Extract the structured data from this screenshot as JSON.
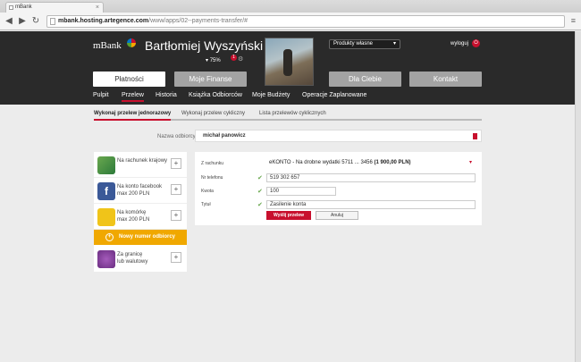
{
  "browser": {
    "tab_title": "mBank",
    "url_domain": "mbank.hosting.artegence.com",
    "url_path": "/www/apps/02--payments-transfer/#"
  },
  "header": {
    "logo": "mBank",
    "user_name": "Bartłomiej Wyszyński",
    "percent": "75%",
    "notifications": "1",
    "products_select": "Produkty własne",
    "logout": "wyloguj"
  },
  "main_tabs": [
    "Płatności",
    "Moje Finanse",
    "Dla Ciebie",
    "Kontakt"
  ],
  "sub_nav": [
    "Pulpit",
    "Przelew",
    "Historia",
    "Książka Odbiorców",
    "Moje Budżety",
    "Operacje Zaplanowane"
  ],
  "transfer_tabs": [
    "Wykonaj przelew jednorazowy",
    "Wykonaj przelew cykliczny",
    "Lista przelewów cyklicznych"
  ],
  "recipient": {
    "label": "Nazwa odbiorcy",
    "value": "michał panowicz"
  },
  "options": [
    {
      "line1": "Na rachunek krajowy",
      "line2": ""
    },
    {
      "line1": "Na konto facebook",
      "line2": "max 200 PLN"
    },
    {
      "line1": "Na komórkę",
      "line2": "max 200 PLN"
    },
    {
      "line1": "Za granicę",
      "line2": "lub walutowy"
    }
  ],
  "new_recipient": "Nowy numer odbiorcy",
  "form": {
    "from_label": "Z rachunku",
    "from_value": "eKONTO - Na drobne wydatki 5711 ... 3456 ",
    "from_balance": "(1 900,00 PLN)",
    "phone_label": "Nr telefonu",
    "phone_value": "519 302 657",
    "amount_label": "Kwota",
    "amount_value": "100",
    "title_label": "Tytuł",
    "title_value": "Zasilenie konta",
    "send": "Wyślij przelew",
    "cancel": "Anuluj"
  },
  "colors": {
    "brand_red": "#c8102e",
    "accent_orange": "#f0a800",
    "header_bg": "#2a2a2a"
  }
}
